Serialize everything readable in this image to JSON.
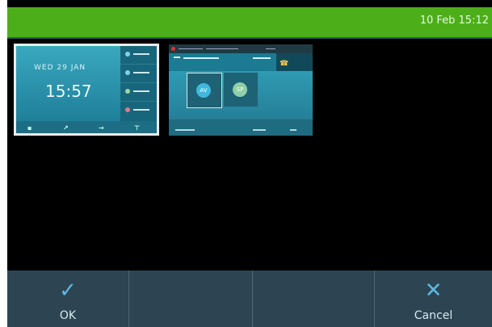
{
  "status_bar": {
    "datetime": "10 Feb 15:12",
    "color": "#4caf1a"
  },
  "thumbnails": [
    {
      "date": "WED  29  JAN",
      "time": "15:57",
      "selected": true
    },
    {
      "avatar_1": "AV",
      "avatar_2": "SP",
      "selected": false
    }
  ],
  "softkeys": {
    "ok_label": "OK",
    "ok_icon": "✓",
    "cancel_label": "Cancel",
    "cancel_icon": "✕"
  }
}
